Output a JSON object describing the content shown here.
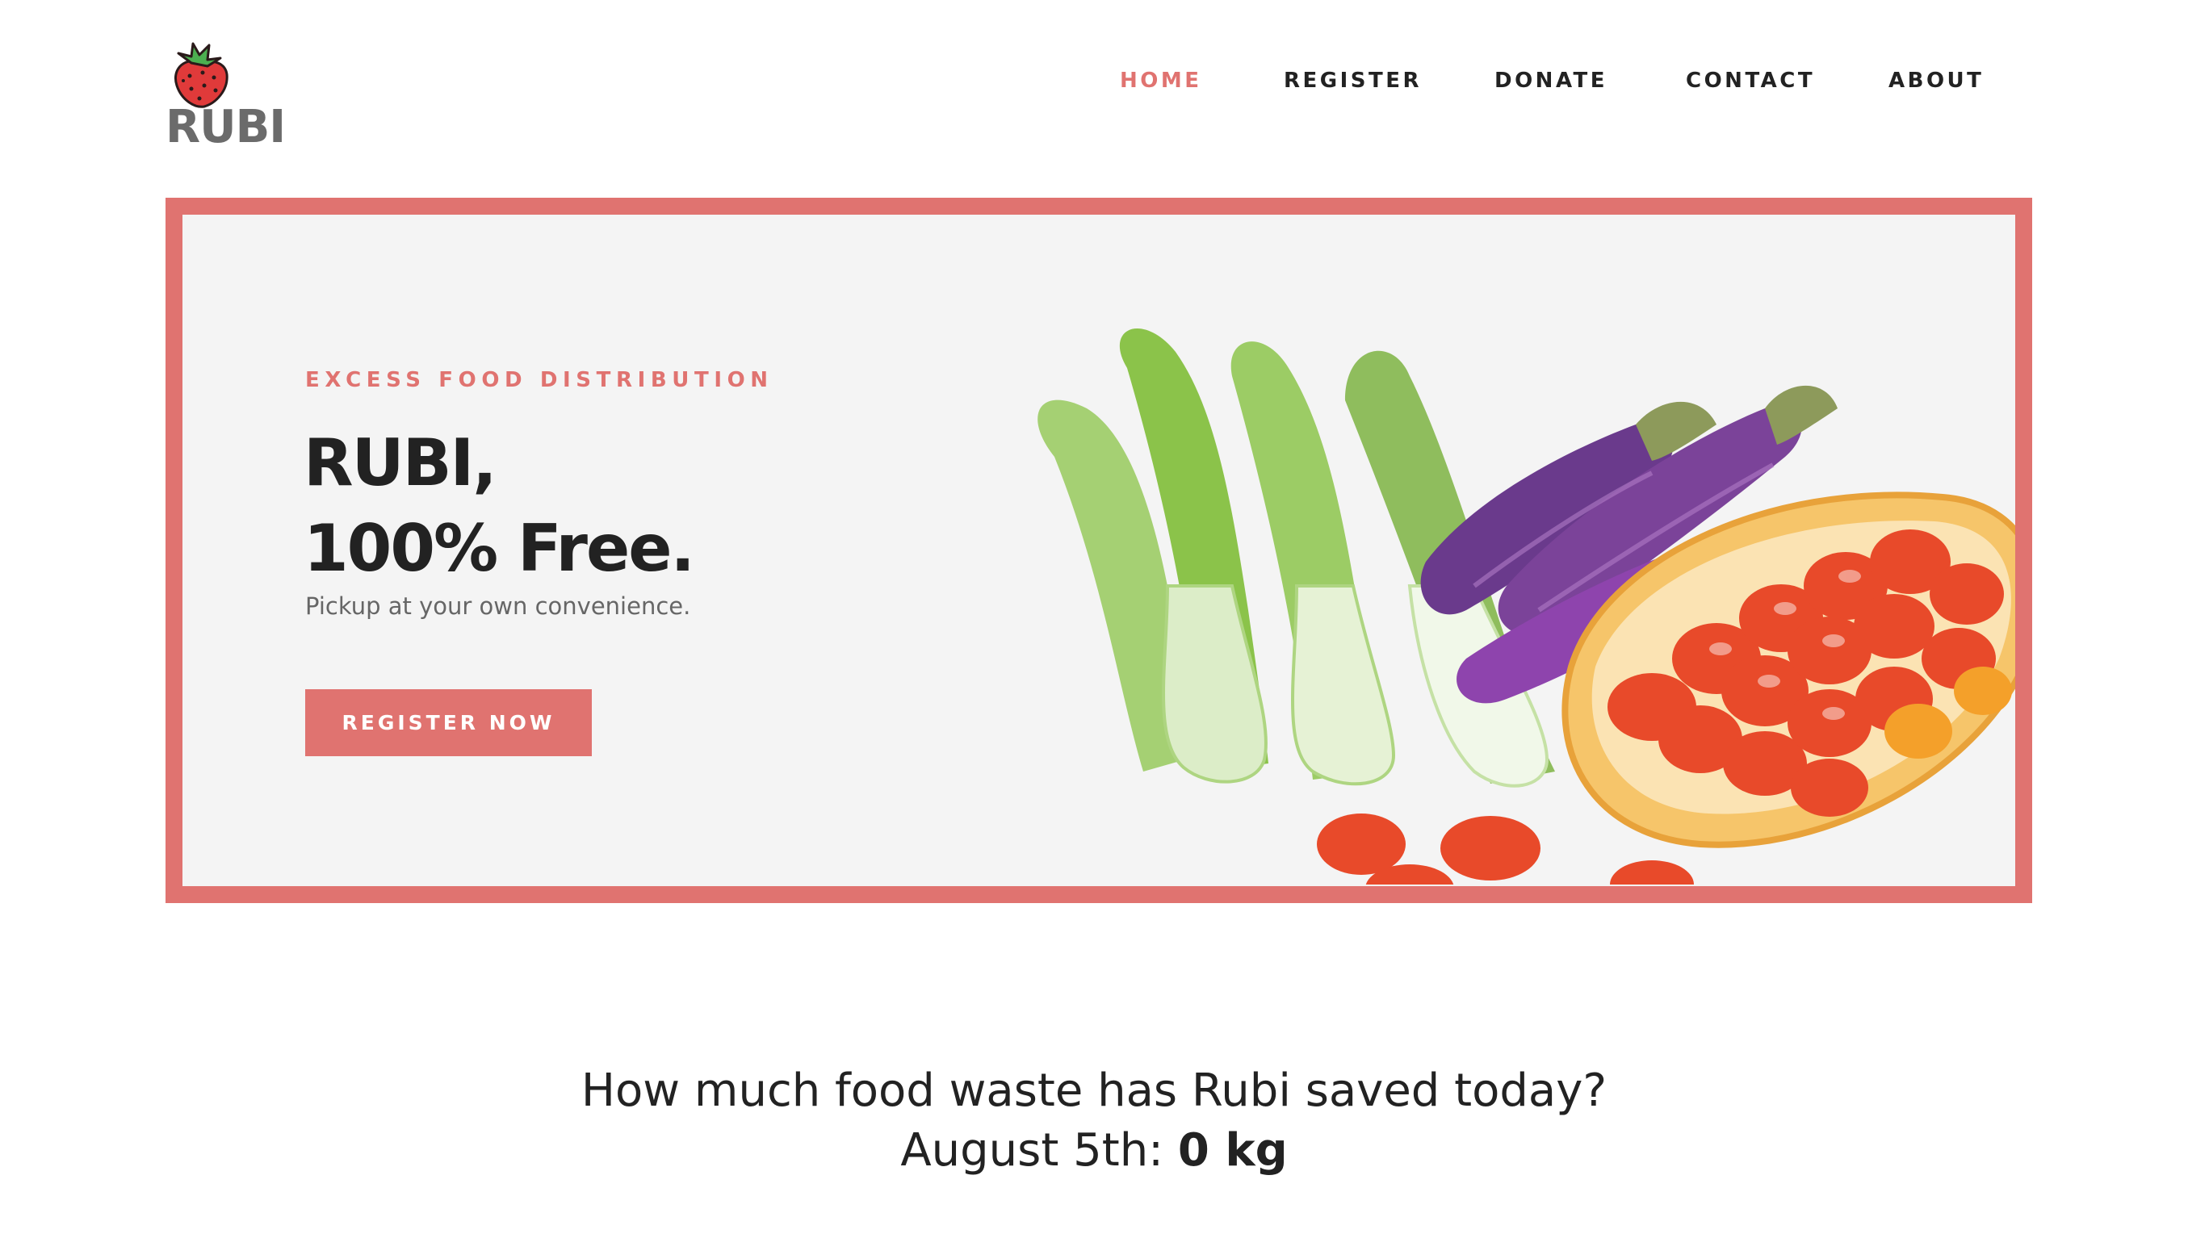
{
  "brand": {
    "name": "RUBI",
    "icon": "strawberry-icon"
  },
  "nav": {
    "items": [
      {
        "label": "HOME",
        "active": true
      },
      {
        "label": "REGISTER",
        "active": false
      },
      {
        "label": "DONATE",
        "active": false
      },
      {
        "label": "CONTACT",
        "active": false
      },
      {
        "label": "ABOUT",
        "active": false
      }
    ]
  },
  "hero": {
    "eyebrow": "EXCESS FOOD DISTRIBUTION",
    "headline_line1": "RUBI,",
    "headline_line2": "100% Free.",
    "subtext": "Pickup at your own convenience.",
    "cta_label": "REGISTER NOW",
    "image": "produce-illustration"
  },
  "stats": {
    "question": "How much food waste has Rubi saved today?",
    "date_label": "August 5th:",
    "amount": "0 kg"
  },
  "colors": {
    "accent": "#e07370",
    "text_dark": "#222222",
    "text_muted": "#666666",
    "logo_gray": "#6b6b6b",
    "hero_bg": "#f4f4f4"
  }
}
